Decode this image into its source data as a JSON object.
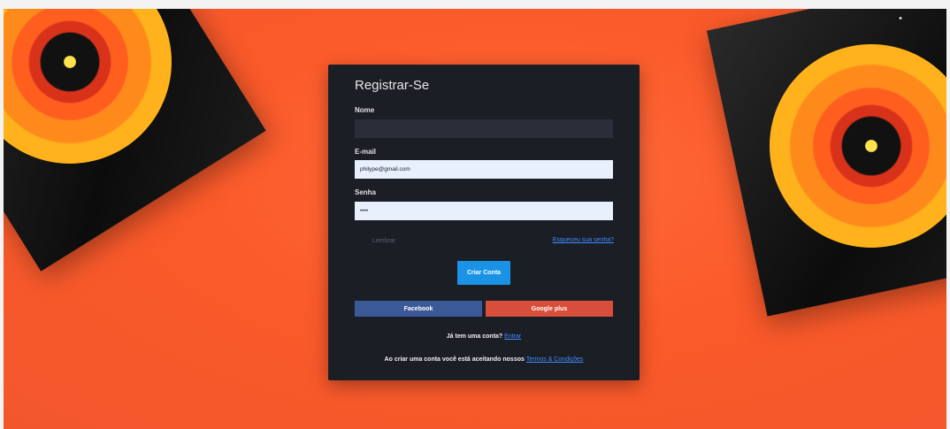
{
  "form": {
    "title": "Registrar-Se",
    "name_label": "Nome",
    "name_value": "",
    "email_label": "E-mail",
    "email_value": "philype@gmail.com",
    "password_label": "Senha",
    "password_value": "••••",
    "remember_label": "Lembrar",
    "forgot_link": "Esqueceu sua senha?",
    "submit_label": "Criar Conta",
    "facebook_label": "Facebook",
    "google_label": "Google plus",
    "have_account_text": "Já tem uma conta?",
    "login_link": "Entrar",
    "terms_text": "Ao criar uma conta você está aceitando nossos",
    "terms_link": "Termos & Condições"
  },
  "icons": {
    "corner": "dot-icon"
  },
  "colors": {
    "background_accent": "#fb5a2a",
    "card_bg": "#1c1e26",
    "submit": "#1a93e6",
    "facebook": "#3b5998",
    "google": "#d94e3a",
    "link": "#3b8cff"
  }
}
